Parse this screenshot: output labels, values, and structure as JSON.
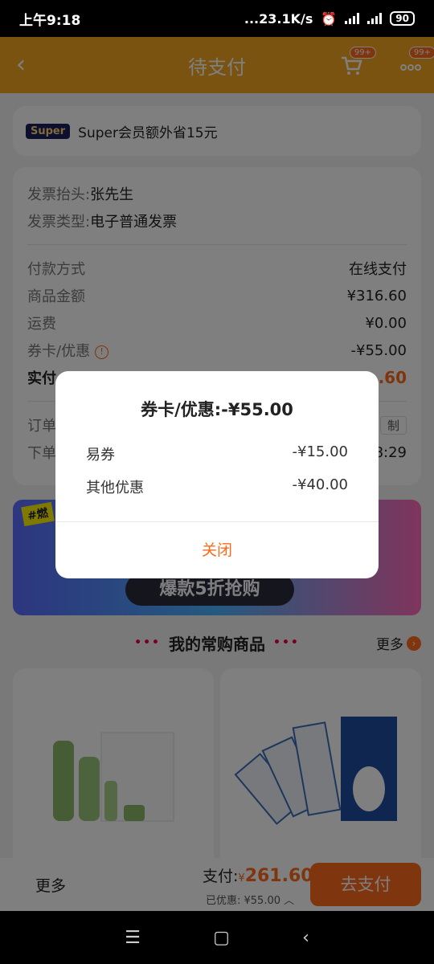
{
  "status_bar": {
    "time": "上午9:18",
    "speed": "...23.1K/s",
    "battery": "90"
  },
  "header": {
    "title": "待支付",
    "cart_badge": "99+",
    "menu_badge": "99+"
  },
  "super_card": {
    "badge": "Super",
    "text": "Super会员额外省15元"
  },
  "invoice": {
    "title_label": "发票抬头:",
    "title_value": "张先生",
    "type_label": "发票类型:",
    "type_value": "电子普通发票"
  },
  "payment": {
    "rows": [
      {
        "label": "付款方式",
        "value": "在线支付"
      },
      {
        "label": "商品金额",
        "value": "¥316.60"
      },
      {
        "label": "运费",
        "value": "¥0.00"
      },
      {
        "label": "券卡/优惠",
        "value": "-¥55.00"
      }
    ],
    "actual_label": "实付",
    "actual_value": ".60",
    "order_label": "订单",
    "copy_label": "制",
    "time_label": "下单",
    "time_value": "8:29"
  },
  "banner": {
    "tag": "#燃",
    "headline": "爆款5折抢购"
  },
  "section": {
    "title": "我的常购商品",
    "more": "更多"
  },
  "bottom_bar": {
    "more": "更多",
    "pay_label": "支付:",
    "yen": "¥",
    "amount": "261.60",
    "discount": "已优惠: ¥55.00",
    "pay_button": "去支付"
  },
  "modal": {
    "title": "券卡/优惠:-¥55.00",
    "rows": [
      {
        "label": "易券",
        "value": "-¥15.00"
      },
      {
        "label": "其他优惠",
        "value": "-¥40.00"
      }
    ],
    "close": "关闭"
  },
  "colors": {
    "accent": "#ff6a1a",
    "header": "#f5a623"
  }
}
